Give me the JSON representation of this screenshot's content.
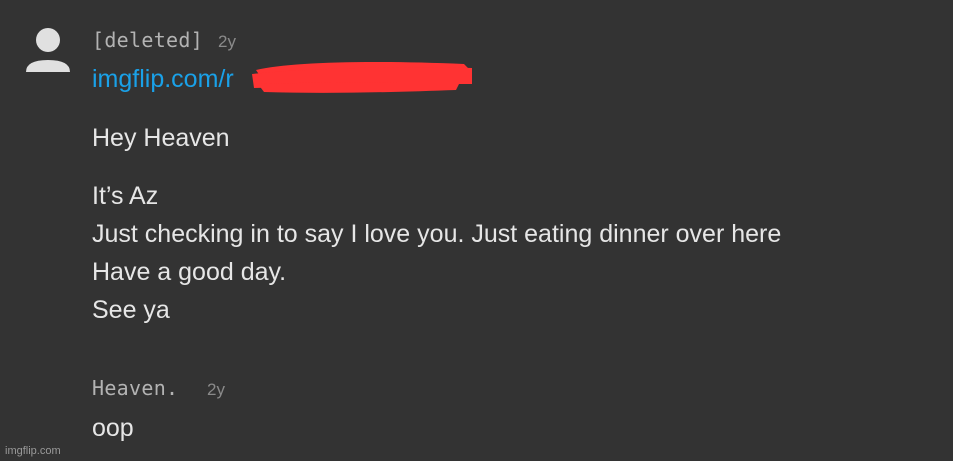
{
  "comments": [
    {
      "author": "[deleted]",
      "age": "2y",
      "link_text": "imgflip.com/r",
      "paragraphs": [
        "Hey Heaven",
        "It’s Az",
        "Just checking in to say I love you. Just eating dinner over here",
        "Have a good day.",
        "See ya"
      ]
    },
    {
      "author": "Heaven.",
      "age": "2y",
      "body": "oop"
    }
  ],
  "watermark": "imgflip.com",
  "colors": {
    "background": "#333333",
    "link": "#1aa1e8",
    "redaction": "#ff3333",
    "author": "#b3b3b3"
  },
  "icons": {
    "avatar": "default-user-avatar-icon"
  }
}
